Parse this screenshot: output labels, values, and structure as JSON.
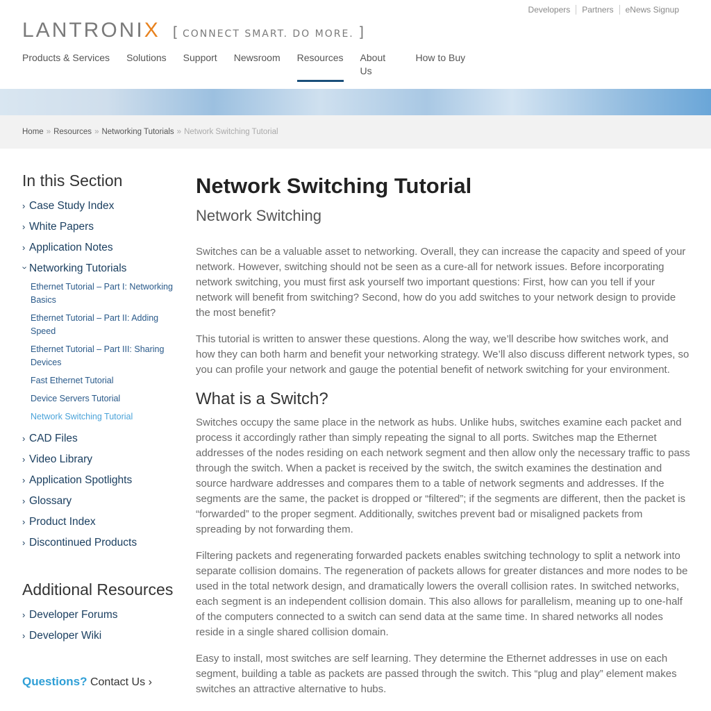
{
  "utility_nav": [
    "Developers",
    "Partners",
    "eNews Signup"
  ],
  "logo": {
    "word_main": "LANTRONI",
    "word_x": "X",
    "tagline": "CONNECT SMART. DO MORE.",
    "bracket_open": "[",
    "bracket_close": "]"
  },
  "main_nav": [
    {
      "label": "Products & Services"
    },
    {
      "label": "Solutions"
    },
    {
      "label": "Support"
    },
    {
      "label": "Newsroom"
    },
    {
      "label": "Resources"
    },
    {
      "label": "About Us"
    },
    {
      "label": "How to Buy"
    }
  ],
  "breadcrumbs": {
    "items": [
      "Home",
      "Resources",
      "Networking Tutorials"
    ],
    "separator": "»",
    "current": "Network Switching Tutorial"
  },
  "sidebar": {
    "section_title": "In this Section",
    "items_top": [
      "Case Study Index",
      "White Papers",
      "Application Notes"
    ],
    "expanded_item": "Networking Tutorials",
    "sub_items": [
      "Ethernet Tutorial – Part I: Networking Basics",
      "Ethernet Tutorial – Part II: Adding Speed",
      "Ethernet Tutorial – Part III: Sharing Devices",
      "Fast Ethernet Tutorial",
      "Device Servers Tutorial",
      "Network Switching Tutorial"
    ],
    "items_bottom": [
      "CAD Files",
      "Video Library",
      "Application Spotlights",
      "Glossary",
      "Product Index",
      "Discontinued Products"
    ],
    "additional_title": "Additional Resources",
    "additional_items": [
      "Developer Forums",
      "Developer Wiki"
    ],
    "questions_label": "Questions?",
    "contact_label": "Contact Us"
  },
  "article": {
    "title": "Network Switching Tutorial",
    "subtitle": "Network Switching",
    "intro_paragraphs": [
      "Switches can be a valuable asset to networking. Overall, they can increase the capacity and speed of your network. However, switching should not be seen as a cure-all for network issues. Before incorporating network switching, you must first ask yourself two important questions: First, how can you tell if your network will benefit from switching? Second, how do you add switches to your network design to provide the most benefit?",
      "This tutorial is written to answer these questions. Along the way, we’ll describe how switches work, and how they can both harm and benefit your networking strategy. We’ll also discuss different network types, so you can profile your network and gauge the potential benefit of network switching for your environment."
    ],
    "section_heading": "What is a Switch?",
    "section_paragraphs": [
      "Switches occupy the same place in the network as hubs. Unlike hubs, switches examine each packet and process it accordingly rather than simply repeating the signal to all ports. Switches map the Ethernet addresses of the nodes residing on each network segment and then allow only the necessary traffic to pass through the switch. When a packet is received by the switch, the switch examines the destination and source hardware addresses and compares them to a table of network segments and addresses. If the segments are the same, the packet is dropped or “filtered”; if the segments are different, then the packet is “forwarded” to the proper segment. Additionally, switches prevent bad or misaligned packets from spreading by not forwarding them.",
      "Filtering packets and regenerating forwarded packets enables switching technology to split a network into separate collision domains. The regeneration of packets allows for greater distances and more nodes to be used in the total network design, and dramatically lowers the overall collision rates. In switched networks, each segment is an independent collision domain. This also allows for parallelism, meaning up to one-half of the computers connected to a switch can send data at the same time. In shared networks all nodes reside in a single shared collision domain.",
      "Easy to install, most switches are self learning. They determine the Ethernet addresses in use on each segment, building a table as packets are passed through the switch. This “plug and play” element makes switches an attractive alternative to hubs."
    ]
  },
  "colors": {
    "accent_orange": "#e8821e",
    "nav_underline": "#1a4f7a",
    "link_blue": "#1b3f60",
    "current_link": "#4ba3d9",
    "questions_blue": "#2f9fd6"
  }
}
